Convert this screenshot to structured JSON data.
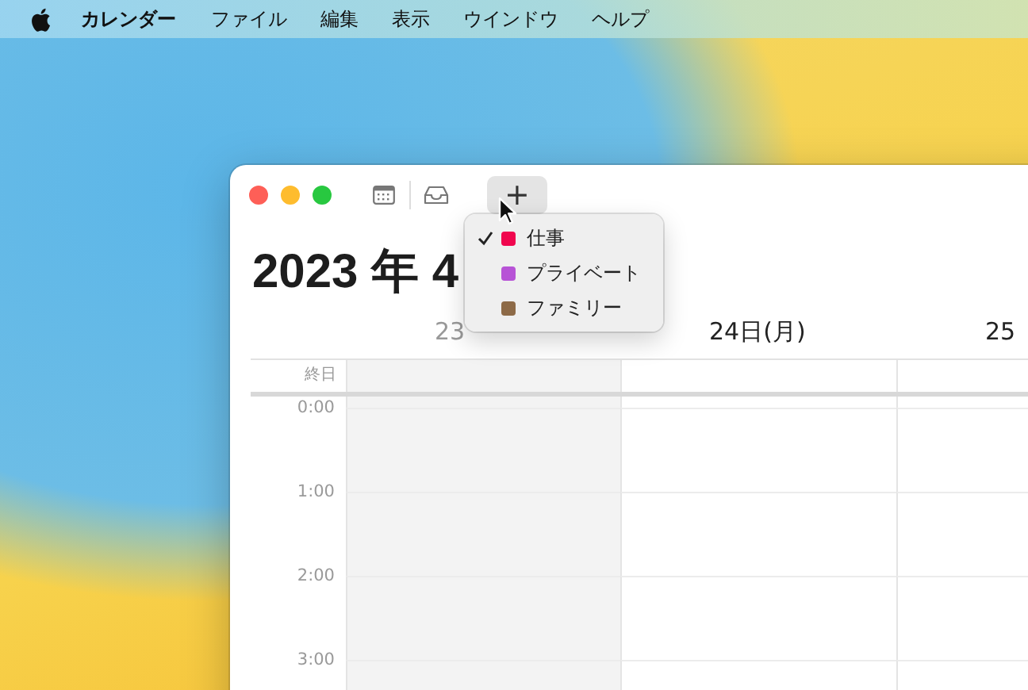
{
  "menu_bar": {
    "app_name": "カレンダー",
    "items": [
      "ファイル",
      "編集",
      "表示",
      "ウインドウ",
      "ヘルプ"
    ]
  },
  "window": {
    "add_button": {
      "label": "+",
      "pressed": true
    },
    "title": "2023 年 4",
    "day_headers": [
      {
        "label": "23",
        "selected": true
      },
      {
        "label": "24日(月)",
        "selected": false
      },
      {
        "label": "25",
        "selected": false
      }
    ],
    "all_day_label": "終日",
    "hours": [
      "0:00",
      "1:00",
      "2:00",
      "3:00"
    ]
  },
  "calendar_menu": {
    "items": [
      {
        "label": "仕事",
        "color": "#f0064e",
        "checked": true
      },
      {
        "label": "プライベート",
        "color": "#b753d6",
        "checked": false
      },
      {
        "label": "ファミリー",
        "color": "#8d6a47",
        "checked": false
      }
    ]
  }
}
